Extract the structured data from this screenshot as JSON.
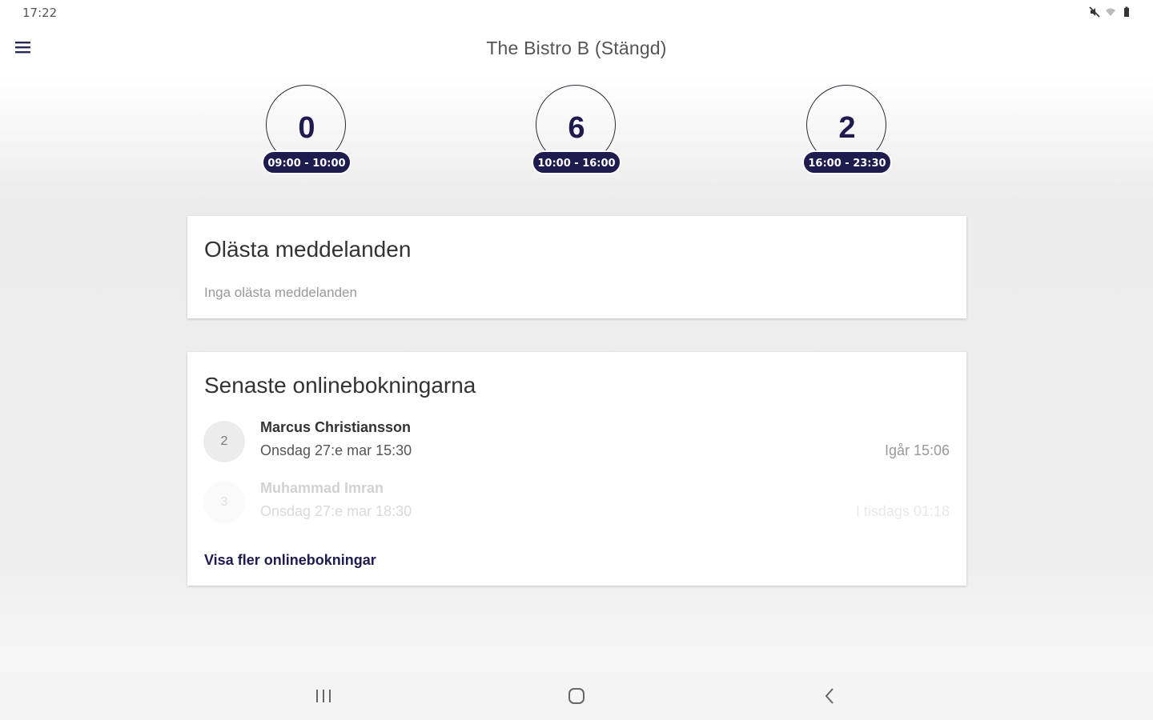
{
  "status_bar": {
    "time": "17:22",
    "icons": [
      "mute-icon",
      "wifi-icon",
      "battery-icon"
    ]
  },
  "app_bar": {
    "title": "The Bistro B (Stängd)",
    "menu_icon": "hamburger-menu-icon"
  },
  "time_slots": [
    {
      "count": "0",
      "range": "09:00 - 10:00"
    },
    {
      "count": "6",
      "range": "10:00 - 16:00"
    },
    {
      "count": "2",
      "range": "16:00 - 23:30"
    }
  ],
  "unread_card": {
    "title": "Olästa meddelanden",
    "empty_text": "Inga olästa meddelanden"
  },
  "bookings_card": {
    "title": "Senaste onlinebokningarna",
    "items": [
      {
        "guests": "2",
        "name": "Marcus Christiansson",
        "date": "Onsdag 27:e mar 15:30",
        "received": "Igår 15:06"
      },
      {
        "guests": "3",
        "name": "Muhammad Imran",
        "date": "Onsdag 27:e mar 18:30",
        "received": "I tisdags 01:18"
      }
    ],
    "show_more": "Visa fler onlinebokningar"
  },
  "nav_bar": {
    "icons": [
      "recent-apps-icon",
      "home-icon",
      "back-icon"
    ]
  },
  "colors": {
    "accent": "#1e1b4f",
    "text": "#333333",
    "muted": "#999999"
  }
}
